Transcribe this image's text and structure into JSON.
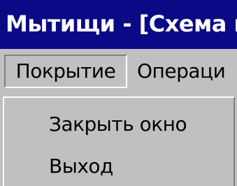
{
  "window": {
    "title": "Мытищи - [Схема п"
  },
  "menubar": {
    "items": [
      {
        "label": "Покрытие",
        "state": "open"
      },
      {
        "label": "Операци"
      }
    ]
  },
  "dropdown": {
    "items": [
      {
        "label": "Закрыть окно"
      },
      {
        "label": "Выход"
      }
    ]
  },
  "colors": {
    "titlebar": "#0a0a86",
    "face": "#c0c0c0",
    "highlight": "#ffffff",
    "shadow": "#808080",
    "title_text": "#ffffff",
    "menu_text": "#000000"
  }
}
